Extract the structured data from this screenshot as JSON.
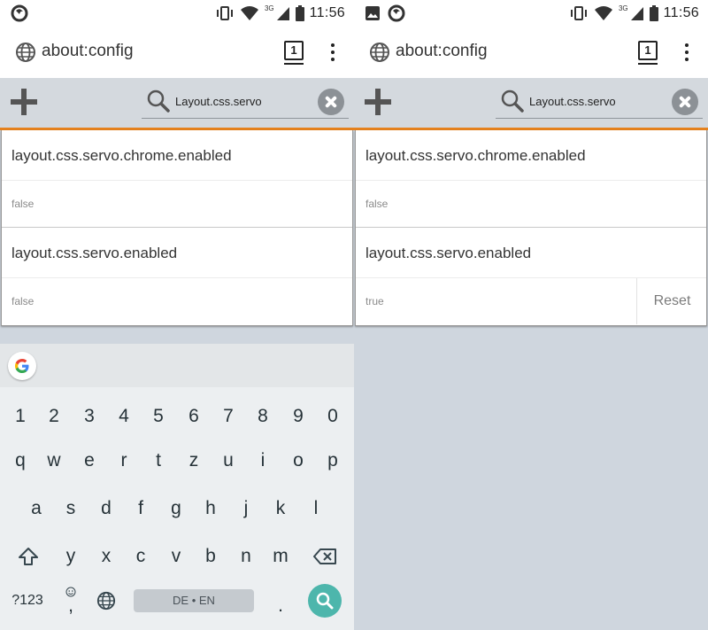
{
  "status": {
    "time": "11:56",
    "network": "3G"
  },
  "urlbar": {
    "url": "about:config",
    "tab_count": "1"
  },
  "search": {
    "query": "Layout.css.servo"
  },
  "panes": [
    {
      "prefs": [
        {
          "name": "layout.css.servo.chrome.enabled",
          "value": "false"
        },
        {
          "name": "layout.css.servo.enabled",
          "value": "false"
        }
      ]
    },
    {
      "prefs": [
        {
          "name": "layout.css.servo.chrome.enabled",
          "value": "false"
        },
        {
          "name": "layout.css.servo.enabled",
          "value": "true",
          "reset_label": "Reset"
        }
      ]
    }
  ],
  "keyboard": {
    "numbers": [
      "1",
      "2",
      "3",
      "4",
      "5",
      "6",
      "7",
      "8",
      "9",
      "0"
    ],
    "row1": [
      "q",
      "w",
      "e",
      "r",
      "t",
      "z",
      "u",
      "i",
      "o",
      "p"
    ],
    "row2": [
      "a",
      "s",
      "d",
      "f",
      "g",
      "h",
      "j",
      "k",
      "l"
    ],
    "row3": [
      "y",
      "x",
      "c",
      "v",
      "b",
      "n",
      "m"
    ],
    "symbols_label": "?123",
    "comma": ",",
    "period": ".",
    "space_label": "DE • EN"
  },
  "colors": {
    "accent_orange": "#e6821e",
    "search_key": "#4db6ac",
    "toolbar_bg": "#d4d9de"
  }
}
